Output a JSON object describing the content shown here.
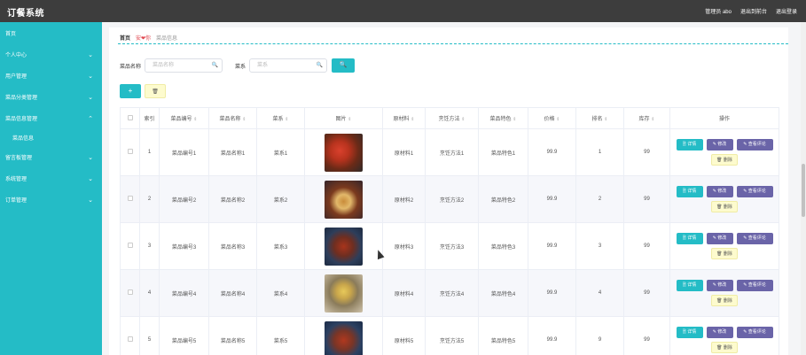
{
  "app": {
    "title": "订餐系统",
    "user_label": "管理员 abo",
    "to_frontend": "退出到前台",
    "logout": "退出登录"
  },
  "sidebar": {
    "items": [
      {
        "label": "首页",
        "chevron": ""
      },
      {
        "label": "个人中心",
        "chevron": "⌄"
      },
      {
        "label": "用户管理",
        "chevron": "⌄"
      },
      {
        "label": "菜品分类管理",
        "chevron": "⌄"
      },
      {
        "label": "菜品信息管理",
        "chevron": "⌃"
      },
      {
        "label": "菜品信息",
        "sub": true
      },
      {
        "label": "留言板管理",
        "chevron": "⌄"
      },
      {
        "label": "系统管理",
        "chevron": "⌄"
      },
      {
        "label": "订单管理",
        "chevron": "⌄"
      }
    ]
  },
  "breadcrumb": {
    "home": "首页",
    "sep": "安❤你",
    "current": "菜品信息"
  },
  "search": {
    "name_label": "菜品名称",
    "name_placeholder": "菜品名称",
    "type_label": "菜系",
    "type_placeholder": "菜系",
    "search_icon": "search-icon",
    "button_icon": "🔍"
  },
  "actions": {
    "add_icon": "+",
    "delete_icon": "🗑"
  },
  "table": {
    "columns": [
      "",
      "索引",
      "菜品编号",
      "菜品名称",
      "菜系",
      "图片",
      "原材料",
      "烹饪方法",
      "菜品特色",
      "价格",
      "排名",
      "库存",
      "操作"
    ],
    "rows": [
      {
        "index": "1",
        "code": "菜品编号1",
        "name": "菜品名称1",
        "cuisine": "菜系1",
        "img": "th1",
        "material": "原材料1",
        "method": "烹饪方法1",
        "feature": "菜品特色1",
        "price": "99.9",
        "rank": "1",
        "stock": "99"
      },
      {
        "index": "2",
        "code": "菜品编号2",
        "name": "菜品名称2",
        "cuisine": "菜系2",
        "img": "th2",
        "material": "原材料2",
        "method": "烹饪方法2",
        "feature": "菜品特色2",
        "price": "99.9",
        "rank": "2",
        "stock": "99"
      },
      {
        "index": "3",
        "code": "菜品编号3",
        "name": "菜品名称3",
        "cuisine": "菜系3",
        "img": "th3",
        "material": "原材料3",
        "method": "烹饪方法3",
        "feature": "菜品特色3",
        "price": "99.9",
        "rank": "3",
        "stock": "99"
      },
      {
        "index": "4",
        "code": "菜品编号4",
        "name": "菜品名称4",
        "cuisine": "菜系4",
        "img": "th4",
        "material": "原材料4",
        "method": "烹饪方法4",
        "feature": "菜品特色4",
        "price": "99.9",
        "rank": "4",
        "stock": "99"
      },
      {
        "index": "5",
        "code": "菜品编号5",
        "name": "菜品名称5",
        "cuisine": "菜系5",
        "img": "th5",
        "material": "原材料5",
        "method": "烹饪方法5",
        "feature": "菜品特色5",
        "price": "99.9",
        "rank": "9",
        "stock": "99"
      }
    ],
    "op_labels": {
      "detail": "🗎 详情",
      "edit": "✎ 修改",
      "review": "✎ 查看评论",
      "delete": "🗑 删除"
    }
  },
  "colors": {
    "primary": "#24bcc6",
    "topbar": "#3d3d3d",
    "purple": "#6a64a8",
    "delete_bg": "#fdfbce"
  }
}
